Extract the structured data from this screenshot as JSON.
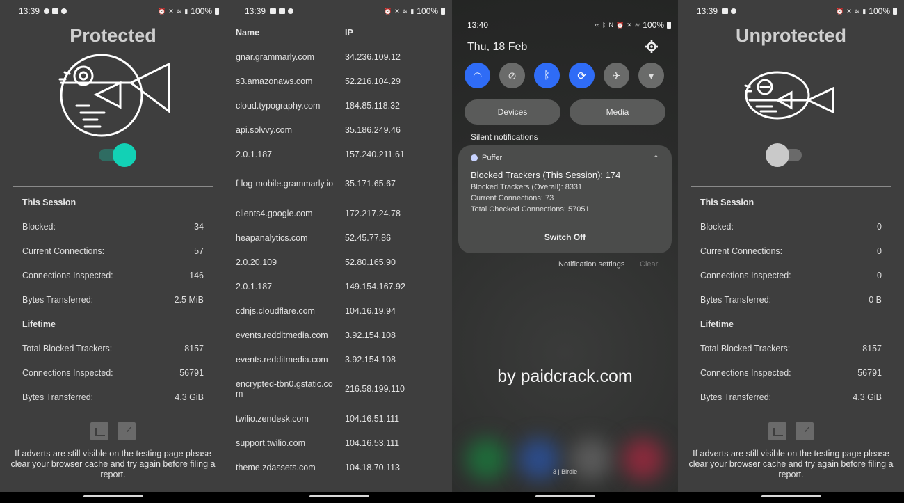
{
  "protected_screen": {
    "status": {
      "time": "13:39",
      "battery": "100%"
    },
    "title": "Protected",
    "toggle_on": true,
    "session_heading": "This Session",
    "session": [
      {
        "label": "Blocked:",
        "value": "34"
      },
      {
        "label": "Current Connections:",
        "value": "57"
      },
      {
        "label": "Connections Inspected:",
        "value": "146"
      },
      {
        "label": "Bytes Transferred:",
        "value": "2.5 MiB"
      }
    ],
    "lifetime_heading": "Lifetime",
    "lifetime": [
      {
        "label": "Total Blocked Trackers:",
        "value": "8157"
      },
      {
        "label": "Connections Inspected:",
        "value": "56791"
      },
      {
        "label": "Bytes Transferred:",
        "value": "4.3 GiB"
      }
    ],
    "footnote": "If adverts are still visible on the testing page please clear your browser cache and try again before filing a report."
  },
  "connections_screen": {
    "status": {
      "time": "13:39",
      "battery": "100%"
    },
    "headers": {
      "name": "Name",
      "ip": "IP"
    },
    "rows": [
      {
        "name": "gnar.grammarly.com",
        "ip": "34.236.109.12"
      },
      {
        "name": "s3.amazonaws.com",
        "ip": "52.216.104.29"
      },
      {
        "name": "cloud.typography.com",
        "ip": "184.85.118.32"
      },
      {
        "name": "api.solvvy.com",
        "ip": "35.186.249.46"
      },
      {
        "name": "2.0.1.187",
        "ip": "157.240.211.61"
      },
      {
        "name": "f-log-mobile.grammarly.io",
        "ip": "35.171.65.67"
      },
      {
        "name": "clients4.google.com",
        "ip": "172.217.24.78"
      },
      {
        "name": "heapanalytics.com",
        "ip": "52.45.77.86"
      },
      {
        "name": "2.0.20.109",
        "ip": "52.80.165.90"
      },
      {
        "name": "2.0.1.187",
        "ip": "149.154.167.92"
      },
      {
        "name": "cdnjs.cloudflare.com",
        "ip": "104.16.19.94"
      },
      {
        "name": "events.redditmedia.com",
        "ip": "3.92.154.108"
      },
      {
        "name": "events.redditmedia.com",
        "ip": "3.92.154.108"
      },
      {
        "name": "encrypted-tbn0.gstatic.com",
        "ip": "216.58.199.110"
      },
      {
        "name": "twilio.zendesk.com",
        "ip": "104.16.51.111"
      },
      {
        "name": "support.twilio.com",
        "ip": "104.16.53.111"
      },
      {
        "name": "theme.zdassets.com",
        "ip": "104.18.70.113"
      }
    ]
  },
  "notification_screen": {
    "status": {
      "time": "13:40",
      "battery": "100%"
    },
    "date": "Thu, 18 Feb",
    "quick_tiles": [
      {
        "icon": "wifi-icon",
        "on": true
      },
      {
        "icon": "mute-icon",
        "on": false
      },
      {
        "icon": "bluetooth-icon",
        "on": true
      },
      {
        "icon": "auto-rotate-icon",
        "on": true
      },
      {
        "icon": "airplane-icon",
        "on": false
      },
      {
        "icon": "flashlight-icon",
        "on": false
      }
    ],
    "devices_label": "Devices",
    "media_label": "Media",
    "silent_label": "Silent notifications",
    "card": {
      "app": "Puffer",
      "headline": "Blocked Trackers (This Session): 174",
      "lines": [
        "Blocked Trackers (Overall): 8331",
        "Current Connections: 73",
        "Total Checked Connections: 57051"
      ],
      "action": "Switch Off"
    },
    "notification_settings": "Notification settings",
    "clear": "Clear",
    "watermark": "by paidcrack.com",
    "pager": "3 | Birdie"
  },
  "unprotected_screen": {
    "status": {
      "time": "13:39",
      "battery": "100%"
    },
    "title": "Unprotected",
    "toggle_on": false,
    "session_heading": "This Session",
    "session": [
      {
        "label": "Blocked:",
        "value": "0"
      },
      {
        "label": "Current Connections:",
        "value": "0"
      },
      {
        "label": "Connections Inspected:",
        "value": "0"
      },
      {
        "label": "Bytes Transferred:",
        "value": "0 B"
      }
    ],
    "lifetime_heading": "Lifetime",
    "lifetime": [
      {
        "label": "Total Blocked Trackers:",
        "value": "8157"
      },
      {
        "label": "Connections Inspected:",
        "value": "56791"
      },
      {
        "label": "Bytes Transferred:",
        "value": "4.3 GiB"
      }
    ],
    "footnote": "If adverts are still visible on the testing page please clear your browser cache and try again before filing a report."
  },
  "colors": {
    "accent": "#12d1b5",
    "qs_on": "#2f6cf6",
    "panel_bg": "#3e3e3e"
  }
}
